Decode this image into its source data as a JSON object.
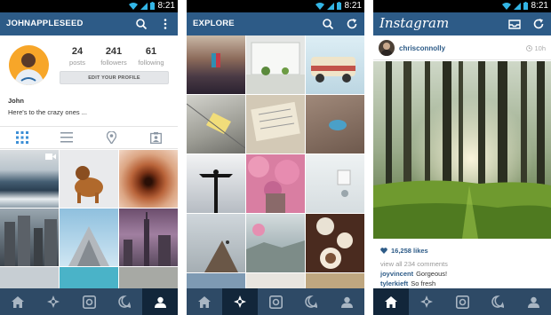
{
  "status_bar": {
    "time": "8:21"
  },
  "screens": {
    "profile": {
      "title": "JOHNAPPLESEED",
      "stats": [
        {
          "num": "24",
          "label": "posts"
        },
        {
          "num": "241",
          "label": "followers"
        },
        {
          "num": "61",
          "label": "following"
        }
      ],
      "edit_button": "EDIT YOUR PROFILE",
      "name": "John",
      "bio": "Here's to the crazy ones ..."
    },
    "explore": {
      "title": "EXPLORE"
    },
    "feed": {
      "logo": "Instagram",
      "post": {
        "username": "chrisconnolly",
        "time": "10h",
        "likes": "16,258 likes",
        "view_comments": "view all 234 comments",
        "comments": [
          {
            "user": "joyvincent",
            "text": "Gorgeous!"
          },
          {
            "user": "tylerkieft",
            "text": "So fresh"
          }
        ]
      }
    }
  },
  "icons": {
    "appbar": [
      "search-icon",
      "more-icon",
      "refresh-icon",
      "inbox-icon"
    ],
    "view_tabs": [
      "grid-view-icon",
      "list-view-icon",
      "map-pin-icon",
      "tagged-photos-icon"
    ],
    "nav": [
      "home-icon",
      "explore-icon",
      "camera-icon",
      "activity-icon",
      "profile-icon"
    ]
  },
  "colors": {
    "appbar": "#2d5b87",
    "tabbar": "#2e4a66",
    "tabbar_active": "#12263a",
    "link": "#2d5b87",
    "avatar_bg": "#f7a629"
  }
}
